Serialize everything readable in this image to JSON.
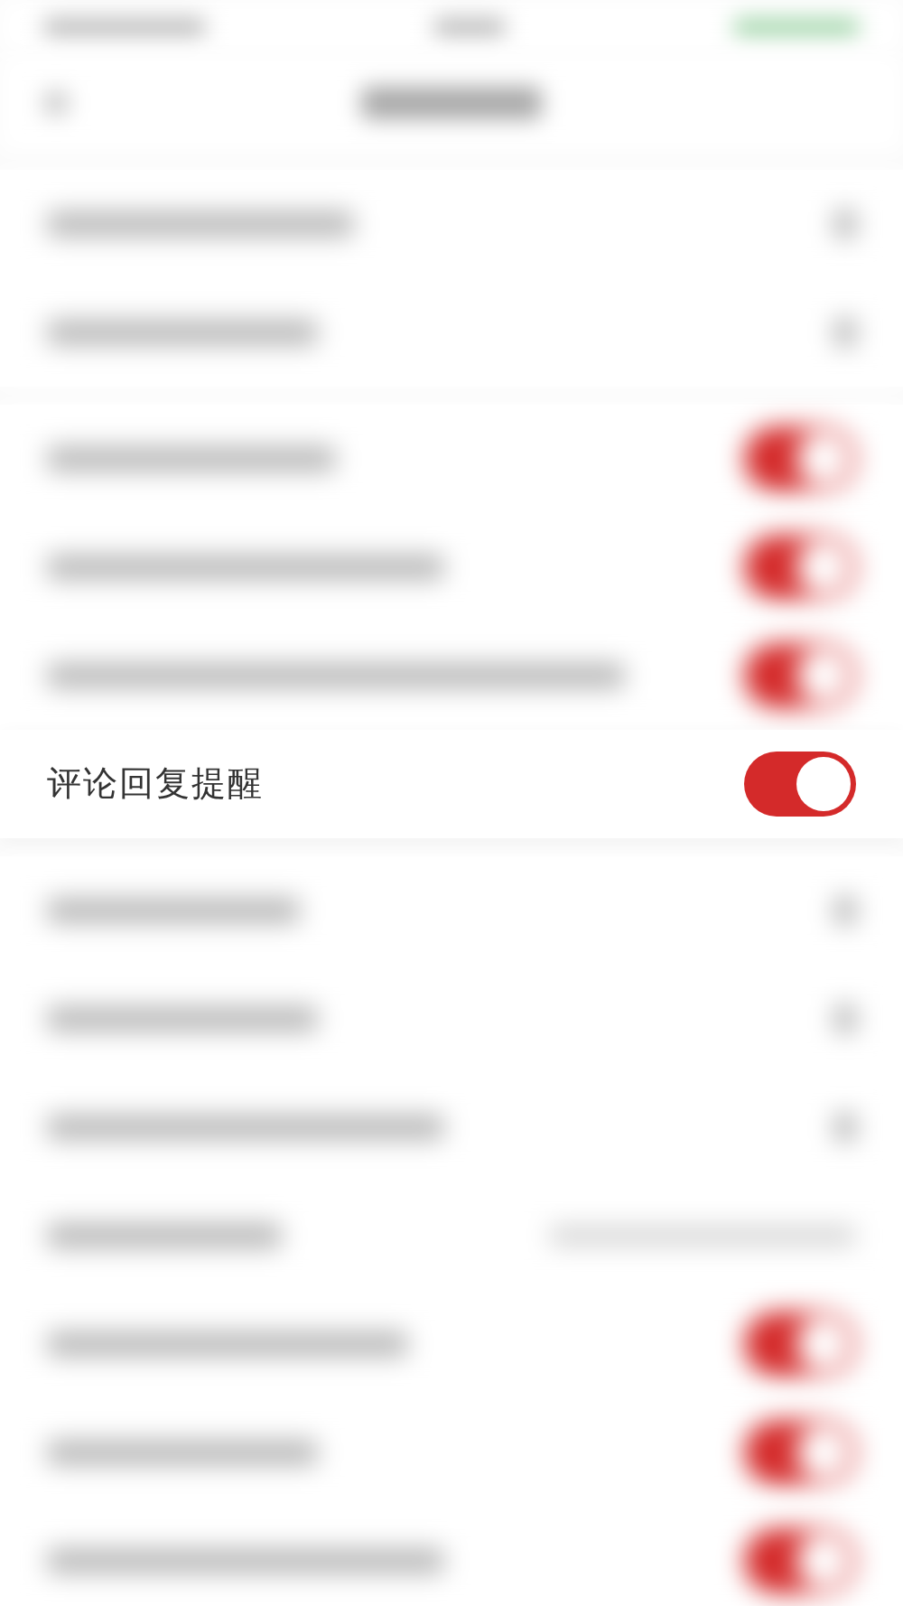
{
  "sections": [
    {
      "rows": [
        {
          "kind": "chevron",
          "blurred": true
        },
        {
          "kind": "chevron",
          "blurred": true
        }
      ]
    },
    {
      "rows": [
        {
          "kind": "toggle",
          "on": true,
          "blurred": true
        },
        {
          "kind": "toggle",
          "on": true,
          "blurred": true
        },
        {
          "kind": "toggle",
          "on": true,
          "blurred": true
        },
        {
          "kind": "toggle",
          "on": true,
          "blurred": false,
          "label": "评论回复提醒"
        }
      ]
    },
    {
      "rows": [
        {
          "kind": "chevron",
          "blurred": true
        },
        {
          "kind": "chevron",
          "blurred": true
        },
        {
          "kind": "chevron",
          "blurred": true
        },
        {
          "kind": "value",
          "blurred": true
        },
        {
          "kind": "toggle",
          "on": true,
          "blurred": true
        },
        {
          "kind": "toggle",
          "on": true,
          "blurred": true
        },
        {
          "kind": "toggle",
          "on": true,
          "blurred": true
        }
      ]
    }
  ]
}
